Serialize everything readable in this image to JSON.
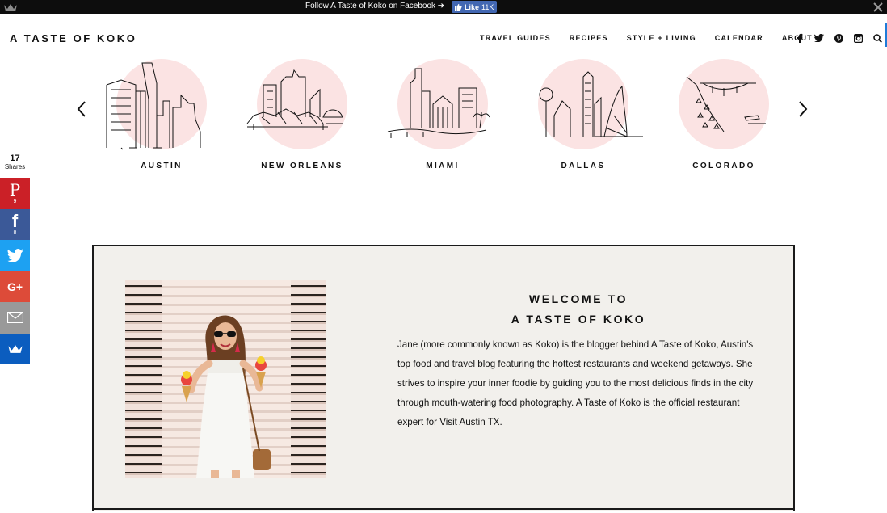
{
  "topbar": {
    "follow_text": "Follow A Taste of Koko on Facebook ➔",
    "like_label": "Like",
    "like_count": "11K"
  },
  "header": {
    "logo": "A TASTE OF KOKO",
    "nav": [
      "TRAVEL GUIDES",
      "RECIPES",
      "STYLE + LIVING",
      "CALENDAR",
      "ABOUT"
    ],
    "social_icons": [
      "facebook-icon",
      "twitter-icon",
      "pinterest-icon",
      "instagram-icon",
      "search-icon"
    ]
  },
  "carousel": {
    "cities": [
      "AUSTIN",
      "NEW ORLEANS",
      "MIAMI",
      "DALLAS",
      "COLORADO"
    ],
    "circle_color": "#fbe3e3"
  },
  "share": {
    "count": "17",
    "label": "Shares",
    "buttons": [
      {
        "name": "pinterest",
        "glyph": "P",
        "count": "9",
        "color": "#cb2027"
      },
      {
        "name": "facebook",
        "glyph": "f",
        "count": "8",
        "color": "#3b5998"
      },
      {
        "name": "twitter",
        "glyph": "",
        "count": "",
        "color": "#1da1f2"
      },
      {
        "name": "google-plus",
        "glyph": "G+",
        "count": "",
        "color": "#dd4b39"
      },
      {
        "name": "email",
        "glyph": "",
        "count": "",
        "color": "#999999"
      },
      {
        "name": "sumo",
        "glyph": "",
        "count": "",
        "color": "#0b5dbf"
      }
    ]
  },
  "welcome": {
    "title_line1": "WELCOME TO",
    "title_line2": "A TASTE OF KOKO",
    "body": "Jane (more commonly known as Koko) is the blogger behind A Taste of Koko, Austin's top food and travel blog featuring the hottest restaurants and weekend getaways. She strives to inspire your inner foodie by guiding you to the most delicious finds in the city through mouth-watering food photography. A Taste of Koko is the official restaurant expert for Visit Austin TX."
  }
}
